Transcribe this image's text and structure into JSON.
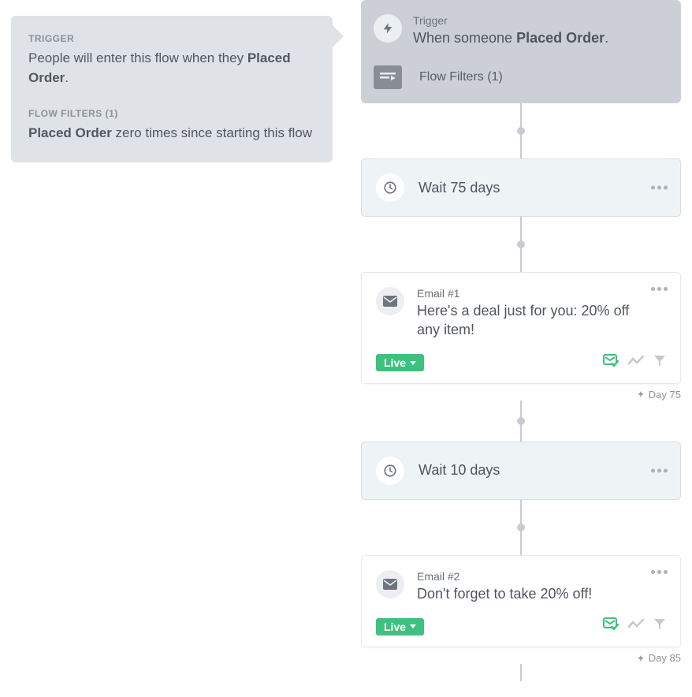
{
  "leftPanel": {
    "triggerLabel": "TRIGGER",
    "triggerTextPrefix": "People will enter this flow when they ",
    "triggerEvent": "Placed Order",
    "filterLabel": "FLOW FILTERS (1)",
    "filterEvent": "Placed Order",
    "filterTextSuffix": " zero times since starting this flow"
  },
  "flow": {
    "trigger": {
      "label": "Trigger",
      "descPrefix": "When someone ",
      "descEvent": "Placed Order",
      "filtersText": "Flow Filters (1)"
    },
    "steps": [
      {
        "type": "wait",
        "text": "Wait 75 days"
      },
      {
        "type": "email",
        "label": "Email #1",
        "title": "Here's a deal just for you: 20% off any item!",
        "status": "Live",
        "dayTag": "Day 75"
      },
      {
        "type": "wait",
        "text": "Wait 10 days"
      },
      {
        "type": "email",
        "label": "Email #2",
        "title": "Don't forget to take 20% off!",
        "status": "Live",
        "dayTag": "Day 85"
      }
    ]
  }
}
